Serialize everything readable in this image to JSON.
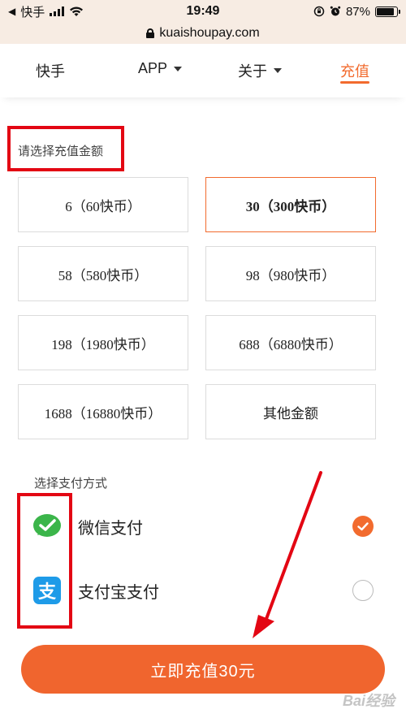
{
  "status_bar": {
    "back_app": "快手",
    "time": "19:49",
    "battery": "87%",
    "battery_level": 0.87
  },
  "url_bar": {
    "url": "kuaishoupay.com"
  },
  "nav": {
    "items": [
      {
        "label": "快手"
      },
      {
        "label": "APP"
      },
      {
        "label": "关于"
      },
      {
        "label": "充值"
      }
    ]
  },
  "amount_section": {
    "title": "请选择充值金额",
    "options": [
      {
        "label": "6（60快币）"
      },
      {
        "label": "30（300快币）",
        "selected": true
      },
      {
        "label": "58（580快币）"
      },
      {
        "label": "98（980快币）"
      },
      {
        "label": "198（1980快币）"
      },
      {
        "label": "688（6880快币）"
      },
      {
        "label": "1688（16880快币）"
      },
      {
        "label": "其他金额"
      }
    ]
  },
  "payment_section": {
    "title": "选择支付方式",
    "methods": [
      {
        "label": "微信支付",
        "icon": "wechat-pay-icon",
        "checked": true
      },
      {
        "label": "支付宝支付",
        "icon": "alipay-icon",
        "checked": false
      }
    ]
  },
  "submit_button": {
    "label": "立即充值30元"
  },
  "watermark": "Bai经验",
  "colors": {
    "accent": "#f26b2e",
    "annotation": "#e30613",
    "wechat": "#3bb54a",
    "alipay": "#1e9be8"
  }
}
